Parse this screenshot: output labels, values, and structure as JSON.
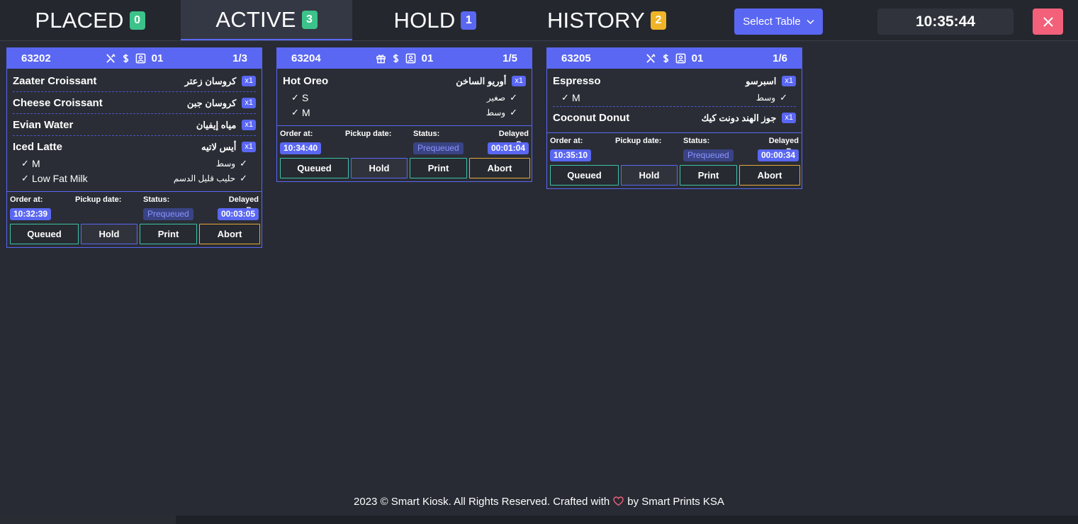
{
  "tabs": [
    {
      "label": "PLACED",
      "count": "0",
      "color": "#3cc38a"
    },
    {
      "label": "ACTIVE",
      "count": "3",
      "color": "#3cc38a"
    },
    {
      "label": "HOLD",
      "count": "1",
      "color": "#5a67f2"
    },
    {
      "label": "HISTORY",
      "count": "2",
      "color": "#f0b429"
    }
  ],
  "toolbar": {
    "select_table_label": "Select Table",
    "clock": "10:35:44",
    "close_icon": "close-icon"
  },
  "meta_labels": {
    "order_at": "Order at:",
    "pickup": "Pickup date:",
    "status": "Status:",
    "delayed": "Delayed By:"
  },
  "action_labels": {
    "queued": "Queued",
    "hold": "Hold",
    "print": "Print",
    "abort": "Abort"
  },
  "cards": [
    {
      "order_id": "63202",
      "icons": [
        "utensils-icon",
        "dollar-icon",
        "user-badge-icon"
      ],
      "table": "01",
      "fraction": "1/3",
      "items": [
        {
          "en": "Zaater Croissant",
          "ar": "كروسان زعتر",
          "qty": "x1",
          "mods": []
        },
        {
          "en": "Cheese Croissant",
          "ar": "كروسان جبن",
          "qty": "x1",
          "mods": []
        },
        {
          "en": "Evian Water",
          "ar": "مياه إيفيان",
          "qty": "x1",
          "mods": []
        },
        {
          "en": "Iced Latte",
          "ar": "أيس لاتيه",
          "qty": "x1",
          "mods": [
            {
              "en": "M",
              "ar": "وسط"
            },
            {
              "en": "Low Fat Milk",
              "ar": "حليب قليل الدسم"
            }
          ]
        }
      ],
      "order_at": "10:32:39",
      "pickup": "",
      "status": "Prequeued",
      "delayed": "00:03:05"
    },
    {
      "order_id": "63204",
      "icons": [
        "gift-box-icon",
        "dollar-icon",
        "user-badge-icon"
      ],
      "table": "01",
      "fraction": "1/5",
      "items": [
        {
          "en": "Hot Oreo",
          "ar": "أوريو الساخن",
          "qty": "x1",
          "mods": [
            {
              "en": "S",
              "ar": "صغير"
            },
            {
              "en": "M",
              "ar": "وسط"
            }
          ]
        }
      ],
      "order_at": "10:34:40",
      "pickup": "",
      "status": "Prequeued",
      "delayed": "00:01:04"
    },
    {
      "order_id": "63205",
      "icons": [
        "utensils-icon",
        "dollar-icon",
        "user-badge-icon"
      ],
      "table": "01",
      "fraction": "1/6",
      "items": [
        {
          "en": "Espresso",
          "ar": "اسبرسو",
          "qty": "x1",
          "mods": [
            {
              "en": "M",
              "ar": "وسط"
            }
          ]
        },
        {
          "en": "Coconut Donut",
          "ar": "جوز الهند دونت كيك",
          "qty": "x1",
          "mods": []
        }
      ],
      "order_at": "10:35:10",
      "pickup": "",
      "status": "Prequeued",
      "delayed": "00:00:34"
    }
  ],
  "footer": {
    "prefix": "2023 © Smart Kiosk. All Rights Reserved. Crafted with",
    "suffix": "by Smart Prints KSA",
    "heart_icon": "heart-icon",
    "heart_color": "#f2607a"
  },
  "colors": {
    "accent": "#5a67f2",
    "background": "#282b33",
    "queued_border": "#3cc3a6",
    "abort_border": "#e8a93a"
  }
}
